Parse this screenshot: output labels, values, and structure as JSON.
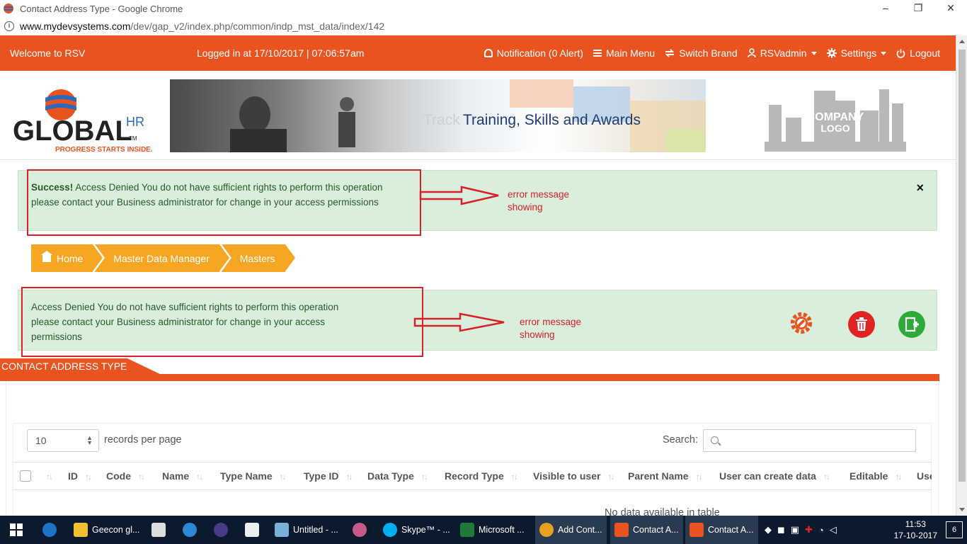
{
  "browser": {
    "window_title": "Contact Address Type - Google Chrome",
    "url_host": "www.mydevsystems.com",
    "url_path": "/dev/gap_v2/index.php/common/indp_mst_data/index/142",
    "controls": [
      "–",
      "❐",
      "✕"
    ]
  },
  "header": {
    "welcome": "Welcome to RSV",
    "logged_in": "Logged in at 17/10/2017 | 07:06:57am",
    "notification": "Notification (0 Alert)",
    "main_menu": "Main Menu",
    "switch_brand": "Switch Brand",
    "user": "RSVadmin",
    "settings": "Settings",
    "logout": "Logout"
  },
  "brand": {
    "logo_text": "GLOBAL",
    "logo_super": "HR",
    "logo_tm": "TM",
    "logo_tagline": "PROGRESS STARTS INSIDE.",
    "banner_title": "Training, Skills and Awards",
    "banner_ghost": "Track",
    "company_logo_line1": "COMPANY",
    "company_logo_line2": "LOGO"
  },
  "alert_top": {
    "strong": "Success!",
    "text": " Access Denied You do not have sufficient rights to perform this operation please contact your Business administrator for change in your access permissions",
    "close": "×"
  },
  "annotation_top": {
    "line1": "error message",
    "line2": "showing"
  },
  "breadcrumb": [
    {
      "label": "Home"
    },
    {
      "label": "Master Data Manager"
    },
    {
      "label": "Masters"
    }
  ],
  "alert_main": {
    "text": "Access Denied You do not have sufficient rights to perform this operation please contact your Business administrator for change in your access permissions"
  },
  "annotation_main": {
    "line1": "error message",
    "line2": "showing"
  },
  "panel": {
    "title": "CONTACT ADDRESS TYPE",
    "records_value": "10",
    "records_label": "records per page",
    "search_label": "Search:",
    "search_placeholder": "",
    "columns": [
      "ID",
      "Code",
      "Name",
      "Type Name",
      "Type ID",
      "Data Type",
      "Record Type",
      "Visible to user",
      "Parent Name",
      "User can create data",
      "Editable",
      "Use"
    ],
    "empty_text": "No data available in table"
  },
  "taskbar": {
    "items": [
      {
        "label": "Geecon gl...",
        "icon": "folder-icon"
      },
      {
        "label": "Untitled - ...",
        "icon": "document-icon"
      },
      {
        "label": "Skype™ - ...",
        "icon": "skype-icon"
      },
      {
        "label": "Microsoft ...",
        "icon": "excel-icon"
      },
      {
        "label": "Add Cont...",
        "icon": "chrome-icon"
      },
      {
        "label": "Contact A...",
        "icon": "app-icon"
      },
      {
        "label": "Contact A...",
        "icon": "app-icon"
      }
    ],
    "time": "11:53",
    "date": "17-10-2017",
    "notifications": "6"
  },
  "colors": {
    "brand_orange": "#e9531f",
    "crumb_orange": "#f6a623",
    "alert_green": "#d9eedb",
    "annotation_red": "#d8202a",
    "delete_red": "#e02424",
    "add_green": "#2eaa3a"
  }
}
